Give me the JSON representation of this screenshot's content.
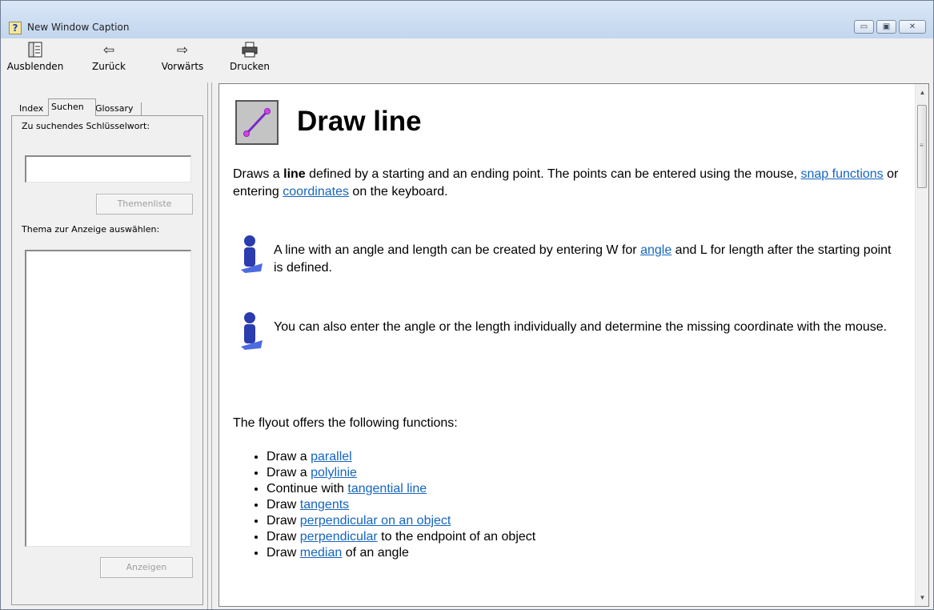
{
  "window": {
    "title": "New Window Caption",
    "buttons": {
      "minimize": "▭",
      "maximize": "▣",
      "close": "✕"
    }
  },
  "toolbar": {
    "hide_label": "Ausblenden",
    "back_label": "Zurück",
    "forward_label": "Vorwärts",
    "print_label": "Drucken"
  },
  "leftpane": {
    "tabs": [
      "Index",
      "Suchen",
      "Glossary"
    ],
    "keyword_label": "Zu suchendes Schlüsselwort:",
    "keyword_value": "",
    "topics_button": "Themenliste",
    "select_topic_label": "Thema zur Anzeige auswählen:",
    "display_button": "Anzeigen"
  },
  "content": {
    "title": "Draw line",
    "intro": {
      "p1": "Draws a ",
      "p1_bold": "line",
      "p2": " defined by a starting and an ending point. The points can be entered using the mouse, ",
      "link_snap": "snap functions",
      "p3": " or entering ",
      "link_coords": "coordinates",
      "p4": " on the keyboard."
    },
    "tip1": {
      "t1": "A line with an angle and length can be created by entering W for ",
      "link_angle": "angle",
      "t2": " and L for length after the starting point is defined."
    },
    "tip2": "You can also enter the angle or the length individually and determine the missing coordinate with the mouse.",
    "flyout_intro": "The flyout offers the following functions:",
    "functions": [
      {
        "pre": "Draw a ",
        "link": "parallel",
        "post": ""
      },
      {
        "pre": "Draw a ",
        "link": "polylinie",
        "post": ""
      },
      {
        "pre": "Continue with ",
        "link": "tangential line",
        "post": ""
      },
      {
        "pre": "Draw ",
        "link": "tangents",
        "post": ""
      },
      {
        "pre": "Draw ",
        "link": "perpendicular on an object",
        "post": ""
      },
      {
        "pre": "Draw ",
        "link": "perpendicular",
        "post": " to the endpoint of an object"
      },
      {
        "pre": "Draw ",
        "link": "median",
        "post": " of an angle"
      }
    ]
  }
}
